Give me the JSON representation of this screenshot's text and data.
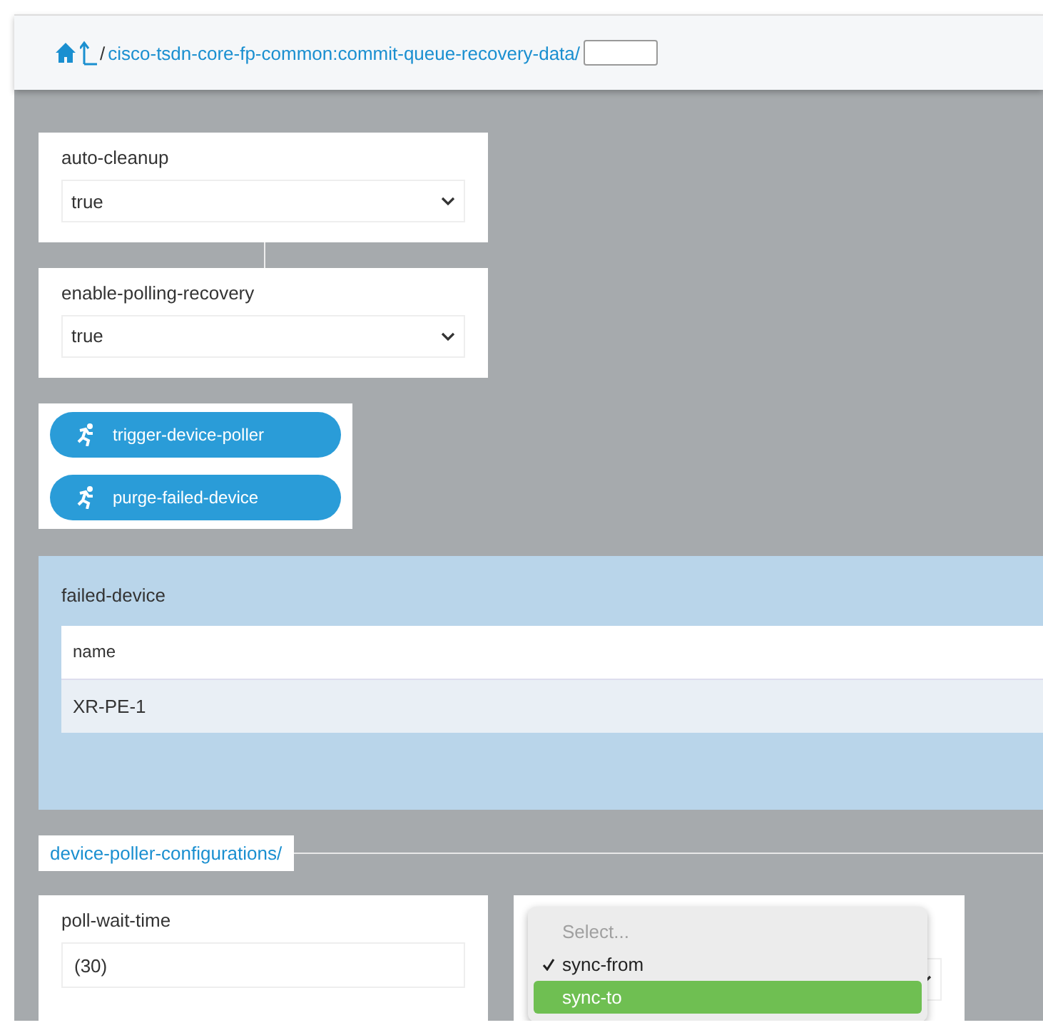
{
  "breadcrumb": {
    "separator": "/",
    "path": "cisco-tsdn-core-fp-common:commit-queue-recovery-data/"
  },
  "fields": [
    {
      "label": "auto-cleanup",
      "kind": "select",
      "value": "true"
    },
    {
      "label": "enable-polling-recovery",
      "kind": "select",
      "value": "true"
    }
  ],
  "actions": [
    "trigger-device-poller",
    "purge-failed-device"
  ],
  "failed_device": {
    "title": "failed-device",
    "columns": [
      "name"
    ],
    "rows": [
      [
        "XR-PE-1"
      ]
    ]
  },
  "section": {
    "title": "device-poller-configurations/"
  },
  "poll_wait_time": {
    "label": "poll-wait-time",
    "placeholder": "(30)"
  },
  "dropdown": {
    "options": [
      {
        "label": "Select...",
        "disabled": true,
        "checked": false,
        "highlighted": false
      },
      {
        "label": "sync-from",
        "disabled": false,
        "checked": true,
        "highlighted": false
      },
      {
        "label": "sync-to",
        "disabled": false,
        "checked": false,
        "highlighted": true
      }
    ]
  }
}
